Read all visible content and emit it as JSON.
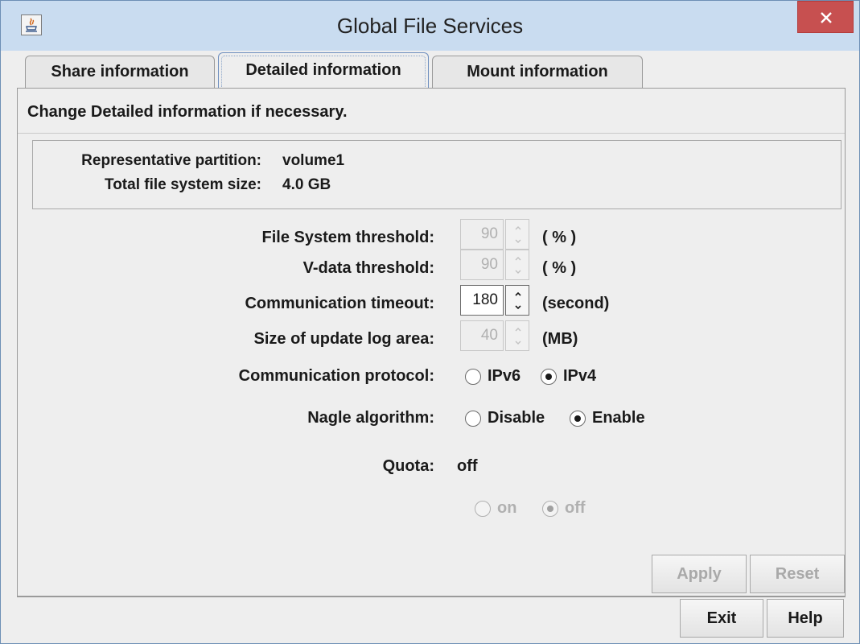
{
  "window": {
    "title": "Global File Services"
  },
  "tabs": [
    {
      "label": "Share information",
      "active": false
    },
    {
      "label": "Detailed information",
      "active": true
    },
    {
      "label": "Mount information",
      "active": false
    }
  ],
  "panel": {
    "heading": "Change Detailed information if necessary.",
    "info": {
      "representative_partition_label": "Representative partition:",
      "representative_partition_value": "volume1",
      "total_size_label": "Total file system size:",
      "total_size_value": "4.0 GB"
    },
    "fields": {
      "fs_threshold": {
        "label": "File System threshold:",
        "value": "90",
        "unit": "( % )",
        "enabled": false
      },
      "vdata_threshold": {
        "label": "V-data threshold:",
        "value": "90",
        "unit": "( % )",
        "enabled": false
      },
      "comm_timeout": {
        "label": "Communication timeout:",
        "value": "180",
        "unit": "(second)",
        "enabled": true
      },
      "update_log_size": {
        "label": "Size of update log area:",
        "value": "40",
        "unit": "(MB)",
        "enabled": false
      }
    },
    "protocol": {
      "label": "Communication protocol:",
      "options": [
        "IPv6",
        "IPv4"
      ],
      "selected": "IPv4"
    },
    "nagle": {
      "label": "Nagle algorithm:",
      "options": [
        "Disable",
        "Enable"
      ],
      "selected": "Enable"
    },
    "quota": {
      "label": "Quota:",
      "value": "off",
      "options": [
        "on",
        "off"
      ],
      "selected": "off",
      "enabled": false
    }
  },
  "buttons": {
    "apply": "Apply",
    "reset": "Reset",
    "exit": "Exit",
    "help": "Help"
  },
  "colors": {
    "titlebar": "#c9dcf0",
    "close_button": "#c75050",
    "panel_bg": "#eeeeee"
  }
}
